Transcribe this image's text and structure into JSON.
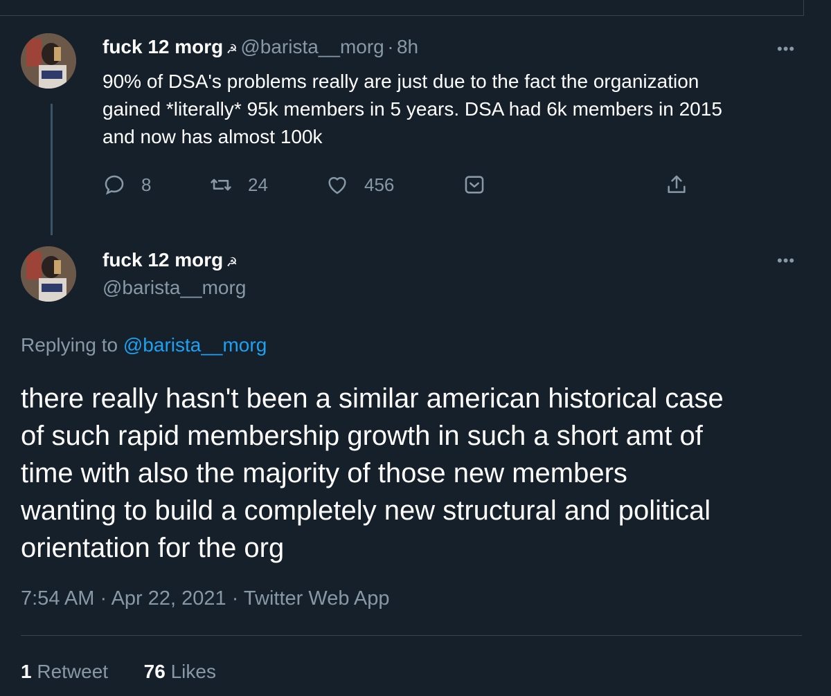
{
  "parent_tweet": {
    "display_name": "fuck 12 morg",
    "name_emoji": "☭",
    "handle": "@barista__morg",
    "separator": "·",
    "time": "8h",
    "text_lines": [
      "90% of DSA's problems really are just due to the fact the organization",
      "gained *literally* 95k members in 5 years. DSA had 6k members in 2015",
      "and now has almost 100k"
    ],
    "replies": "8",
    "retweets": "24",
    "likes": "456",
    "more_label": "•••"
  },
  "main_tweet": {
    "display_name": "fuck 12 morg",
    "name_emoji": "☭",
    "handle": "@barista__morg",
    "more_label": "•••",
    "replying_prefix": "Replying to",
    "replying_handle": "@barista__morg",
    "text_lines": [
      "there really hasn't been a similar american historical case",
      "of such rapid membership growth in such a short amt of",
      "time with also the majority of those new members",
      "wanting to build a completely new structural and political",
      "orientation for the org"
    ],
    "meta": "7:54 AM · Apr 22, 2021 · Twitter Web App",
    "retweet_count": "1",
    "retweet_label": "Retweet",
    "like_count": "76",
    "like_label": "Likes"
  },
  "colors": {
    "background": "#15202b",
    "secondary_text": "#8899a6",
    "link": "#1da1f2",
    "divider": "#38444d"
  }
}
